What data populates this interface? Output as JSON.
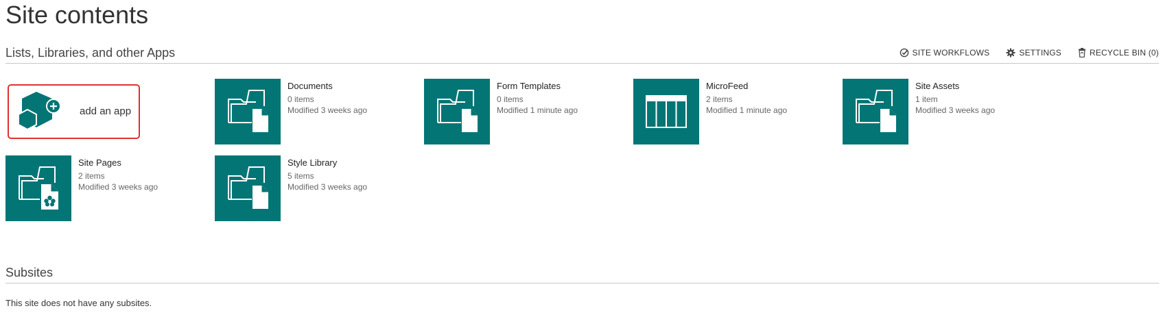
{
  "page_title": "Site contents",
  "lists_section": {
    "title": "Lists, Libraries, and other Apps",
    "actions": [
      {
        "label": "SITE WORKFLOWS",
        "icon": "workflow-icon"
      },
      {
        "label": "SETTINGS",
        "icon": "gear-icon"
      },
      {
        "label": "RECYCLE BIN (0)",
        "icon": "recycle-bin-icon"
      }
    ],
    "add_app_label": "add an app",
    "apps": [
      {
        "name": "Documents",
        "items": "0 items",
        "modified": "Modified 3 weeks ago",
        "icon": "document-library-icon"
      },
      {
        "name": "Form Templates",
        "items": "0 items",
        "modified": "Modified 1 minute ago",
        "icon": "document-library-icon"
      },
      {
        "name": "MicroFeed",
        "items": "2 items",
        "modified": "Modified 1 minute ago",
        "icon": "list-icon"
      },
      {
        "name": "Site Assets",
        "items": "1 item",
        "modified": "Modified 3 weeks ago",
        "icon": "document-library-icon"
      },
      {
        "name": "Site Pages",
        "items": "2 items",
        "modified": "Modified 3 weeks ago",
        "icon": "wiki-page-library-icon"
      },
      {
        "name": "Style Library",
        "items": "5 items",
        "modified": "Modified 3 weeks ago",
        "icon": "document-library-icon"
      }
    ]
  },
  "subsites_section": {
    "title": "Subsites",
    "empty_message": "This site does not have any subsites."
  },
  "colors": {
    "tile": "#037575",
    "add_app_highlight": "#e03030"
  }
}
